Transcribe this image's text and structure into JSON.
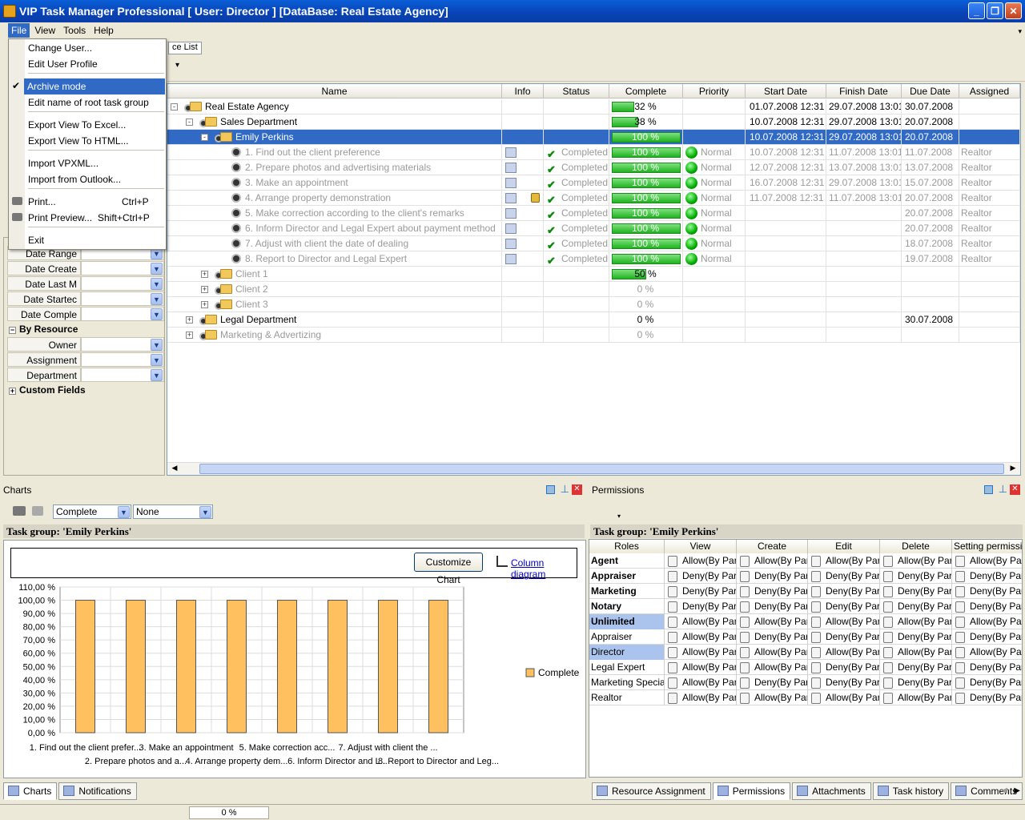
{
  "window": {
    "title": "VIP Task Manager Professional [ User: Director ] [DataBase: Real Estate Agency]"
  },
  "menubar": {
    "items": [
      "File",
      "View",
      "Tools",
      "Help"
    ]
  },
  "file_menu": {
    "items": [
      {
        "label": "Change User...",
        "shortcut": ""
      },
      {
        "label": "Edit User Profile",
        "shortcut": ""
      },
      {
        "label": "Archive mode",
        "shortcut": "",
        "checked": true
      },
      {
        "label": "Edit name of root task group",
        "shortcut": ""
      },
      {
        "label": "Export View To Excel...",
        "shortcut": ""
      },
      {
        "label": "Export View To HTML...",
        "shortcut": ""
      },
      {
        "label": "Import VPXML...",
        "shortcut": ""
      },
      {
        "label": "Import from Outlook...",
        "shortcut": ""
      },
      {
        "label": "Print...",
        "shortcut": "Ctrl+P"
      },
      {
        "label": "Print Preview...",
        "shortcut": "Shift+Ctrl+P"
      },
      {
        "label": "Exit",
        "shortcut": ""
      }
    ]
  },
  "tabs": {
    "resource_list": "ce List"
  },
  "tree": {
    "columns": [
      "Name",
      "Info",
      "Status",
      "Complete",
      "Priority",
      "Start Date",
      "Finish Date",
      "Due Date",
      "Assigned"
    ],
    "rows": [
      {
        "name": "Real Estate Agency",
        "level": 0,
        "type": "group",
        "expand": "-",
        "complete": "32 %",
        "pct": 32,
        "status": "",
        "priority": "",
        "start": "01.07.2008 12:31",
        "finish": "29.07.2008 13:01",
        "due": "30.07.2008",
        "assigned": "",
        "dim": false
      },
      {
        "name": "Sales Department",
        "level": 1,
        "type": "group",
        "expand": "-",
        "complete": "38 %",
        "pct": 38,
        "status": "",
        "priority": "",
        "start": "10.07.2008 12:31",
        "finish": "29.07.2008 13:01",
        "due": "20.07.2008",
        "assigned": "",
        "dim": false
      },
      {
        "name": "Emily Perkins",
        "level": 2,
        "type": "group",
        "expand": "-",
        "complete": "100 %",
        "pct": 100,
        "status": "",
        "priority": "",
        "start": "10.07.2008 12:31",
        "finish": "29.07.2008 13:01",
        "due": "20.07.2008",
        "assigned": "",
        "dim": false,
        "selected": true
      },
      {
        "name": "1. Find out the client preference",
        "level": 3,
        "type": "task",
        "complete": "100 %",
        "pct": 100,
        "status": "Completed",
        "priority": "Normal",
        "start": "10.07.2008 12:31",
        "finish": "11.07.2008 13:01",
        "due": "11.07.2008",
        "assigned": "Realtor",
        "dim": true
      },
      {
        "name": "2. Prepare photos and advertising materials",
        "level": 3,
        "type": "task",
        "complete": "100 %",
        "pct": 100,
        "status": "Completed",
        "priority": "Normal",
        "start": "12.07.2008 12:31",
        "finish": "13.07.2008 13:01",
        "due": "13.07.2008",
        "assigned": "Realtor",
        "dim": true
      },
      {
        "name": "3. Make an appointment",
        "level": 3,
        "type": "task",
        "complete": "100 %",
        "pct": 100,
        "status": "Completed",
        "priority": "Normal",
        "start": "16.07.2008 12:31",
        "finish": "29.07.2008 13:01",
        "due": "15.07.2008",
        "assigned": "Realtor",
        "dim": true
      },
      {
        "name": "4. Arrange property demonstration",
        "level": 3,
        "type": "task",
        "complete": "100 %",
        "pct": 100,
        "status": "Completed",
        "priority": "Normal",
        "start": "11.07.2008 12:31",
        "finish": "11.07.2008 13:01",
        "due": "20.07.2008",
        "assigned": "Realtor",
        "dim": true,
        "lock": true
      },
      {
        "name": "5. Make correction according to the client's remarks",
        "level": 3,
        "type": "task",
        "complete": "100 %",
        "pct": 100,
        "status": "Completed",
        "priority": "Normal",
        "start": "",
        "finish": "",
        "due": "20.07.2008",
        "assigned": "Realtor",
        "dim": true
      },
      {
        "name": "6. Inform Director and Legal Expert about payment method",
        "level": 3,
        "type": "task",
        "complete": "100 %",
        "pct": 100,
        "status": "Completed",
        "priority": "Normal",
        "start": "",
        "finish": "",
        "due": "20.07.2008",
        "assigned": "Realtor",
        "dim": true
      },
      {
        "name": "7. Adjust with client the date of dealing",
        "level": 3,
        "type": "task",
        "complete": "100 %",
        "pct": 100,
        "status": "Completed",
        "priority": "Normal",
        "start": "",
        "finish": "",
        "due": "18.07.2008",
        "assigned": "Realtor",
        "dim": true
      },
      {
        "name": "8. Report to Director and Legal Expert",
        "level": 3,
        "type": "task",
        "complete": "100 %",
        "pct": 100,
        "status": "Completed",
        "priority": "Normal",
        "start": "",
        "finish": "",
        "due": "19.07.2008",
        "assigned": "Realtor",
        "dim": true
      },
      {
        "name": "Client 1",
        "level": 2,
        "type": "group",
        "expand": "+",
        "complete": "50 %",
        "pct": 50,
        "status": "",
        "priority": "",
        "start": "",
        "finish": "",
        "due": "",
        "assigned": "",
        "dim": true
      },
      {
        "name": "Client 2",
        "level": 2,
        "type": "group",
        "expand": "+",
        "complete": "0 %",
        "pct": 0,
        "status": "",
        "priority": "",
        "start": "",
        "finish": "",
        "due": "",
        "assigned": "",
        "dim": true
      },
      {
        "name": "Client 3",
        "level": 2,
        "type": "group",
        "expand": "+",
        "complete": "0 %",
        "pct": 0,
        "status": "",
        "priority": "",
        "start": "",
        "finish": "",
        "due": "",
        "assigned": "",
        "dim": true
      },
      {
        "name": "Legal Department",
        "level": 1,
        "type": "group",
        "expand": "+",
        "complete": "0 %",
        "pct": 0,
        "status": "",
        "priority": "",
        "start": "",
        "finish": "",
        "due": "30.07.2008",
        "assigned": "",
        "dim": false
      },
      {
        "name": "Marketing & Advertizing",
        "level": 1,
        "type": "group",
        "expand": "+",
        "complete": "0 %",
        "pct": 0,
        "status": "",
        "priority": "",
        "start": "",
        "finish": "",
        "due": "",
        "assigned": "",
        "dim": true
      }
    ]
  },
  "filters": {
    "rows": [
      {
        "kind": "field",
        "label": "Date Range"
      },
      {
        "kind": "field",
        "label": "Date Create"
      },
      {
        "kind": "field",
        "label": "Date Last M"
      },
      {
        "kind": "field",
        "label": "Date Startec"
      },
      {
        "kind": "field",
        "label": "Date Comple"
      },
      {
        "kind": "group",
        "label": "By Resource",
        "sign": "−"
      },
      {
        "kind": "field",
        "label": "Owner"
      },
      {
        "kind": "field",
        "label": "Assignment"
      },
      {
        "kind": "field",
        "label": "Department"
      },
      {
        "kind": "group",
        "label": "Custom Fields",
        "sign": "+"
      }
    ]
  },
  "charts_panel": {
    "title": "Charts",
    "combo1": "Complete",
    "combo2": "None",
    "group_title": "Task group: 'Emily Perkins'",
    "customize_button": "Customize Chart",
    "diagram_link": "Column diagram",
    "legend": "Complete"
  },
  "chart_data": {
    "type": "bar",
    "categories": [
      "1. Find out the client prefer...",
      "2. Prepare photos and a...",
      "3. Make an appointment",
      "4. Arrange property dem...",
      "5. Make correction acc...",
      "6. Inform Director and L...",
      "7. Adjust with client the ...",
      "8. Report to Director and Leg..."
    ],
    "series": [
      {
        "name": "Complete",
        "values": [
          100,
          100,
          100,
          100,
          100,
          100,
          100,
          100
        ]
      }
    ],
    "yticks": [
      "0,00 %",
      "10,00 %",
      "20,00 %",
      "30,00 %",
      "40,00 %",
      "50,00 %",
      "60,00 %",
      "70,00 %",
      "80,00 %",
      "90,00 %",
      "100,00 %",
      "110,00 %"
    ],
    "ylim": [
      0,
      110
    ],
    "grid": true,
    "legend_position": "right",
    "bar_color": "#ffc060"
  },
  "permissions_panel": {
    "title": "Permissions",
    "group_title": "Task group: 'Emily Perkins'",
    "columns": [
      "Roles",
      "View",
      "Create",
      "Edit",
      "Delete",
      "Setting permissions"
    ],
    "rows": [
      {
        "role": "Agent",
        "bold": true,
        "highlight": false,
        "cells": [
          "Allow(By Parent)",
          "Allow(By Parent)",
          "Allow(By Parent)",
          "Allow(By Parent)",
          "Allow(By Parent)"
        ]
      },
      {
        "role": "Appraiser",
        "bold": true,
        "highlight": false,
        "cells": [
          "Deny(By Parent)",
          "Deny(By Parent)",
          "Deny(By Parent)",
          "Deny(By Parent)",
          "Deny(By Parent)"
        ]
      },
      {
        "role": "Marketing",
        "bold": true,
        "highlight": false,
        "cells": [
          "Deny(By Parent)",
          "Deny(By Parent)",
          "Deny(By Parent)",
          "Deny(By Parent)",
          "Deny(By Parent)"
        ]
      },
      {
        "role": "Notary",
        "bold": true,
        "highlight": false,
        "cells": [
          "Deny(By Parent)",
          "Deny(By Parent)",
          "Deny(By Parent)",
          "Deny(By Parent)",
          "Deny(By Parent)"
        ]
      },
      {
        "role": "Unlimited",
        "bold": true,
        "highlight": true,
        "cells": [
          "Allow(By Parent)",
          "Allow(By Parent)",
          "Allow(By Parent)",
          "Allow(By Parent)",
          "Allow(By Parent)"
        ]
      },
      {
        "role": "Appraiser",
        "bold": false,
        "highlight": false,
        "cells": [
          "Allow(By Parent)",
          "Deny(By Parent)",
          "Deny(By Parent)",
          "Deny(By Parent)",
          "Deny(By Parent)"
        ]
      },
      {
        "role": "Director",
        "bold": false,
        "highlight": true,
        "cells": [
          "Allow(By Parent)",
          "Allow(By Parent)",
          "Allow(By Parent)",
          "Allow(By Parent)",
          "Allow(By Parent)"
        ]
      },
      {
        "role": "Legal Expert",
        "bold": false,
        "highlight": false,
        "cells": [
          "Allow(By Parent)",
          "Allow(By Parent)",
          "Deny(By Parent)",
          "Deny(By Parent)",
          "Deny(By Parent)"
        ]
      },
      {
        "role": "Marketing Specialist",
        "bold": false,
        "highlight": false,
        "cells": [
          "Allow(By Parent)",
          "Deny(By Parent)",
          "Deny(By Parent)",
          "Deny(By Parent)",
          "Deny(By Parent)"
        ]
      },
      {
        "role": "Realtor",
        "bold": false,
        "highlight": false,
        "cells": [
          "Allow(By Parent)",
          "Allow(By Parent)",
          "Allow(By Parent)",
          "Allow(By Parent)",
          "Deny(By Parent)"
        ]
      }
    ]
  },
  "bottom_tabs_left": [
    "Charts",
    "Notifications"
  ],
  "bottom_tabs_right": [
    "Resource Assignment",
    "Permissions",
    "Attachments",
    "Task history",
    "Comments"
  ],
  "statusbar": {
    "progress": "0 %"
  }
}
